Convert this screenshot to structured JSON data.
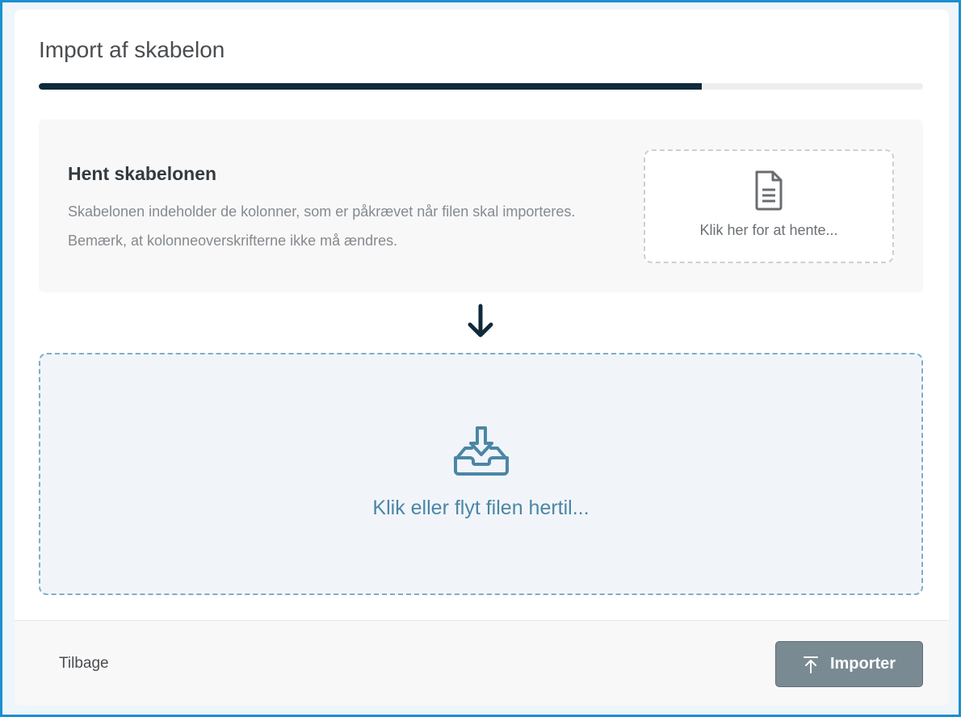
{
  "dialog": {
    "title": "Import af skabelon",
    "progress_fraction": 0.75
  },
  "template": {
    "heading": "Hent skabelonen",
    "description": "Skabelonen indeholder de kolonner, som er påkrævet når filen skal importeres. Bemærk, at kolonneoverskrifterne ikke må ændres.",
    "download_label": "Klik her for at hente...",
    "download_icon": "document-icon"
  },
  "flow_icon": "arrow-down-icon",
  "dropzone": {
    "label": "Klik eller flyt filen hertil...",
    "icon": "inbox-download-icon"
  },
  "footer": {
    "back_label": "Tilbage",
    "import_label": "Importer",
    "import_icon": "upload-to-top-icon"
  },
  "colors": {
    "accent": "#1b8fd0",
    "progress": "#0f2a3a",
    "dropzone_text": "#4b86a6",
    "import_button": "#7a8a93"
  }
}
